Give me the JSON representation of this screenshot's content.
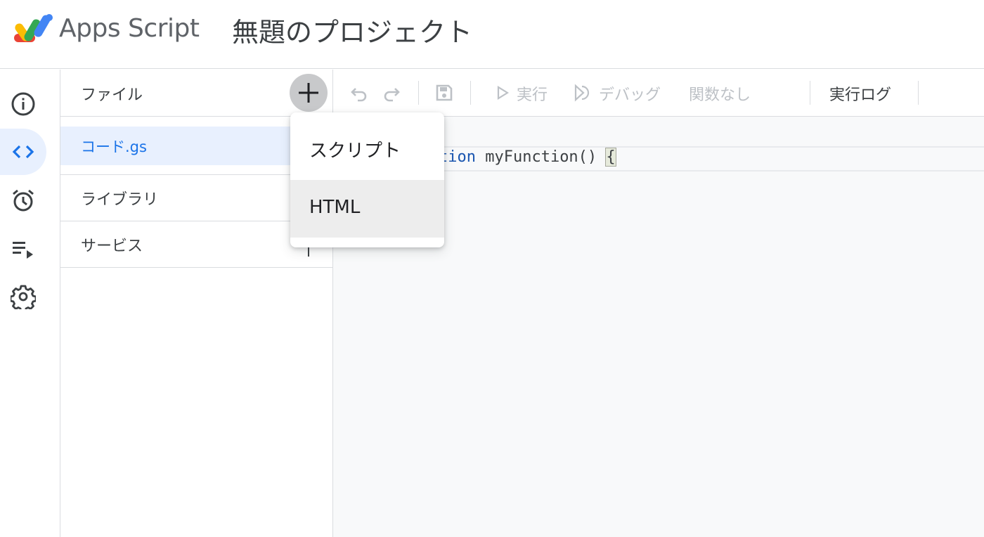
{
  "header": {
    "app_name": "Apps Script",
    "project_title": "無題のプロジェクト",
    "logo_icon": "apps-script-logo-icon"
  },
  "rail": {
    "items": [
      {
        "name": "overview",
        "icon": "info-icon",
        "active": false
      },
      {
        "name": "editor",
        "icon": "code-icon",
        "active": true
      },
      {
        "name": "triggers",
        "icon": "alarm-clock-icon",
        "active": false
      },
      {
        "name": "executions",
        "icon": "playlist-play-icon",
        "active": false
      },
      {
        "name": "settings",
        "icon": "gear-icon",
        "active": false
      }
    ]
  },
  "files_panel": {
    "header_label": "ファイル",
    "add_icon": "plus-icon",
    "files": [
      {
        "label": "コード.gs"
      }
    ],
    "sections": [
      {
        "label": "ライブラリ"
      },
      {
        "label": "サービス"
      }
    ]
  },
  "toolbar": {
    "undo_icon": "undo-icon",
    "redo_icon": "redo-icon",
    "save_icon": "save-icon",
    "run_label": "実行",
    "debug_label": "デバッグ",
    "function_select": "関数なし",
    "log_label": "実行ログ"
  },
  "editor": {
    "keyword_visible": "tion",
    "code_rest": " myFunction() ",
    "brace": "{"
  },
  "add_menu": {
    "items": [
      {
        "label": "スクリプト"
      },
      {
        "label": "HTML"
      }
    ]
  },
  "colors": {
    "accent": "#1a73e8",
    "active_bg": "#e8f0fe",
    "border": "#dadce0",
    "disabled_text": "#bdc1c6"
  }
}
